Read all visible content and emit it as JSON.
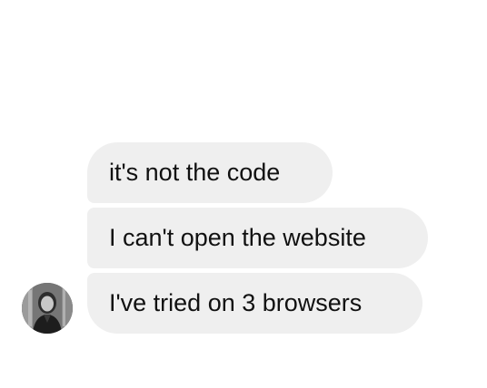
{
  "conversation": {
    "messages": [
      {
        "text": "it's not the code"
      },
      {
        "text": "I can't open the website"
      },
      {
        "text": "I've tried on 3 browsers"
      }
    ],
    "sender": {
      "avatar_icon": "profile-photo"
    }
  },
  "colors": {
    "bubble": "#efefef",
    "text": "#111111",
    "background": "#ffffff"
  }
}
